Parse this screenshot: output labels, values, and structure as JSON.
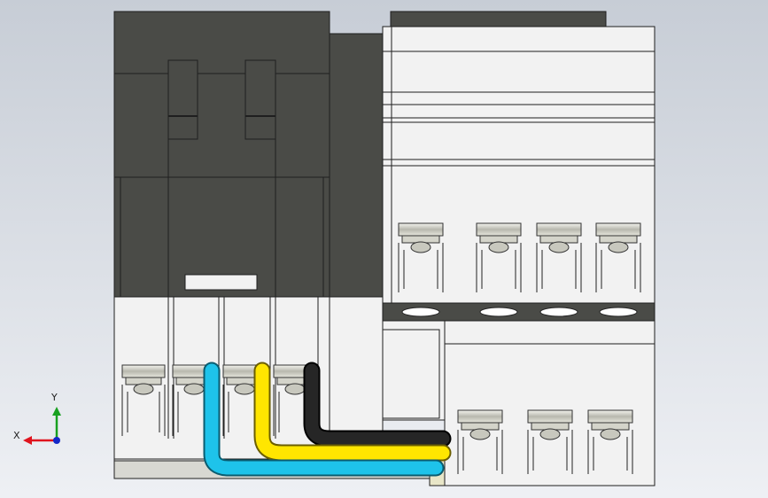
{
  "viewport": {
    "background_top": "#c7cdd6",
    "background_bottom": "#eef0f4"
  },
  "model": {
    "body_dark": "#4a4b47",
    "body_light": "#f2f2f2",
    "edge": "#1f1f1f"
  },
  "wires": [
    {
      "name": "cyan",
      "color": "#1ec3ea"
    },
    {
      "name": "yellow",
      "color": "#ffe600"
    },
    {
      "name": "black",
      "color": "#262626"
    }
  ],
  "triad": {
    "x_label": "X",
    "y_label": "Y",
    "x_color": "#e0141e",
    "y_color": "#18a020",
    "z_color": "#1428c8"
  }
}
